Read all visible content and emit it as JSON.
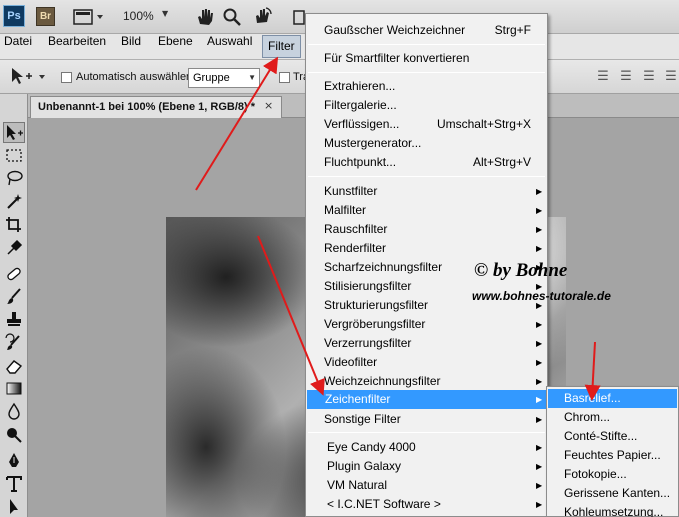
{
  "appbar": {
    "ps_logo": "Ps",
    "br_logo": "Br",
    "zoom": "100%",
    "icons": [
      "screen-mode-icon",
      "hand-tool-icon",
      "zoom-tool-icon",
      "rotate-view-icon",
      "arrange-documents-icon"
    ]
  },
  "menubar": {
    "items": [
      "Datei",
      "Bearbeiten",
      "Bild",
      "Ebene",
      "Auswahl",
      "Filter"
    ],
    "active": "Filter"
  },
  "options": {
    "auto_select_label": "Automatisch auswählen:",
    "auto_select_value": "Gruppe",
    "transform_label": "Tra"
  },
  "document": {
    "tab_title": "Unbenannt-1 bei 100% (Ebene 1, RGB/8) *",
    "close_label": "×"
  },
  "filter_menu": {
    "last_filter": "Gaußscher Weichzeichner",
    "last_filter_shortcut": "Strg+F",
    "smart_filter": "Für Smartfilter konvertieren",
    "special": [
      {
        "label": "Extrahieren...",
        "shortcut": ""
      },
      {
        "label": "Filtergalerie...",
        "shortcut": ""
      },
      {
        "label": "Verflüssigen...",
        "shortcut": "Umschalt+Strg+X"
      },
      {
        "label": "Mustergenerator...",
        "shortcut": ""
      },
      {
        "label": "Fluchtpunkt...",
        "shortcut": "Alt+Strg+V"
      }
    ],
    "categories": [
      "Kunstfilter",
      "Malfilter",
      "Rauschfilter",
      "Renderfilter",
      "Scharfzeichnungsfilter",
      "Stilisierungsfilter",
      "Strukturierungsfilter",
      "Vergröberungsfilter",
      "Verzerrungsfilter",
      "Videofilter",
      "Weichzeichnungsfilter",
      "Zeichenfilter",
      "Sonstige Filter"
    ],
    "highlighted": "Zeichenfilter",
    "plugins": [
      "Eye Candy 4000",
      "Plugin Galaxy",
      "VM Natural",
      "< I.C.NET Software >"
    ]
  },
  "submenu": {
    "items": [
      "Basrelief...",
      "Chrom...",
      "Conté-Stifte...",
      "Feuchtes Papier...",
      "Fotokopie...",
      "Gerissene Kanten...",
      "Kohleumsetzung..."
    ],
    "highlighted": "Basrelief..."
  },
  "watermark": {
    "line1": "© by Bohne",
    "line2": "www.bohnes-tutorale.de"
  },
  "colors": {
    "highlight": "#3399ff",
    "arrow": "#e01b1b"
  }
}
